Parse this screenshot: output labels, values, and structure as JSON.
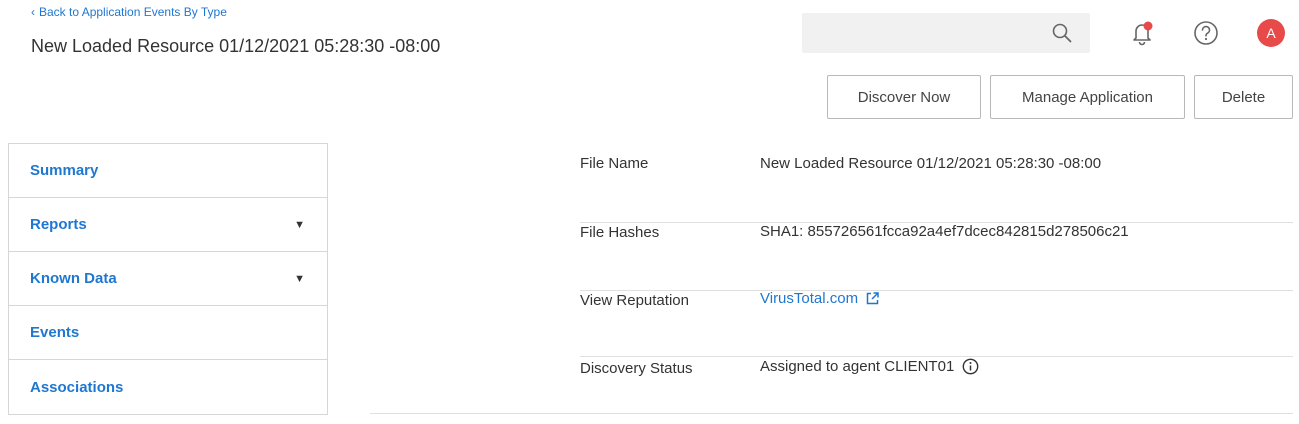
{
  "header": {
    "back_link": "Back to Application Events By Type",
    "title": "New Loaded Resource 01/12/2021 05:28:30 -08:00",
    "search_placeholder": "",
    "avatar_initial": "A",
    "notification_dot_color": "#e84a4a"
  },
  "actions": {
    "discover_now": "Discover Now",
    "manage_application": "Manage Application",
    "delete": "Delete"
  },
  "sidebar": {
    "items": [
      {
        "label": "Summary",
        "expandable": false
      },
      {
        "label": "Reports",
        "expandable": true
      },
      {
        "label": "Known Data",
        "expandable": true
      },
      {
        "label": "Events",
        "expandable": false
      },
      {
        "label": "Associations",
        "expandable": false
      }
    ]
  },
  "details": {
    "file_name": {
      "label": "File Name",
      "value": "New Loaded Resource 01/12/2021 05:28:30 -08:00"
    },
    "file_hashes": {
      "label": "File Hashes",
      "value": "SHA1: 855726561fcca92a4ef7dcec842815d278506c21"
    },
    "view_reputation": {
      "label": "View Reputation",
      "value": "VirusTotal.com"
    },
    "discovery_status": {
      "label": "Discovery Status",
      "value": "Assigned to agent CLIENT01"
    }
  },
  "colors": {
    "accent": "#1f77d0",
    "avatar": "#e84a4a",
    "text": "#333333"
  },
  "icons": {
    "search": "search-icon",
    "notifications": "bell-icon",
    "help": "help-icon",
    "external_link": "external-link-icon",
    "info": "info-icon",
    "caret": "caret-down-icon",
    "back": "chevron-left-icon"
  }
}
